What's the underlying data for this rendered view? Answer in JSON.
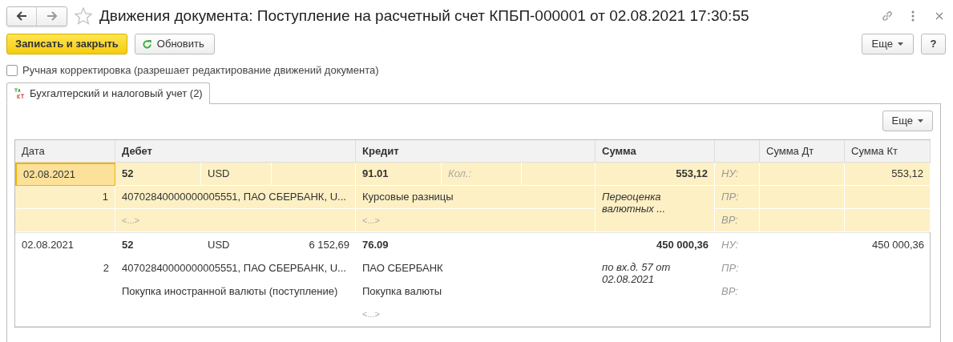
{
  "window": {
    "title": "Движения документа: Поступление на расчетный счет КПБП-000001 от 02.08.2021 17:30:55"
  },
  "toolbar": {
    "save_close": "Записать и закрыть",
    "refresh": "Обновить",
    "more": "Еще",
    "help": "?"
  },
  "manual_edit": {
    "label": "Ручная корректировка (разрешает редактирование движений документа)",
    "checked": false
  },
  "tabs": [
    {
      "label": "Бухгалтерский и налоговый учет (2)",
      "selected": true
    }
  ],
  "table_more": "Еще",
  "columns": [
    "Дата",
    "Дебет",
    "Кредит",
    "Сумма",
    "",
    "Сумма Дт",
    "Сумма Кт"
  ],
  "records": [
    {
      "selected": true,
      "date": "02.08.2021",
      "number": "1",
      "debit": {
        "account": "52",
        "currency": "USD",
        "subconto": [
          "40702840000000005551, ПАО СБЕРБАНК, U...",
          "<...>"
        ]
      },
      "credit": {
        "account": "91.01",
        "qty_label": "Кол.:",
        "subconto": [
          "Курсовые разницы",
          "<...>"
        ]
      },
      "sum": "553,12",
      "note": "Переоценка валютных ...",
      "tax_labels": [
        "НУ:",
        "ПР:",
        "ВР:"
      ],
      "sum_kt": "553,12"
    },
    {
      "selected": false,
      "date": "02.08.2021",
      "number": "2",
      "debit": {
        "account": "52",
        "currency": "USD",
        "amount": "6 152,69",
        "subconto": [
          "40702840000000005551, ПАО СБЕРБАНК, U...",
          "Покупка иностранной валюты (поступление)"
        ]
      },
      "credit": {
        "account": "76.09",
        "subconto": [
          "ПАО СБЕРБАНК",
          "Покупка валюты",
          "<...>"
        ]
      },
      "sum": "450 000,36",
      "note": " по вх.д. 57 от 02.08.2021",
      "tax_labels": [
        "НУ:",
        "ПР:",
        "ВР:"
      ],
      "sum_kt": "450 000,36"
    }
  ]
}
